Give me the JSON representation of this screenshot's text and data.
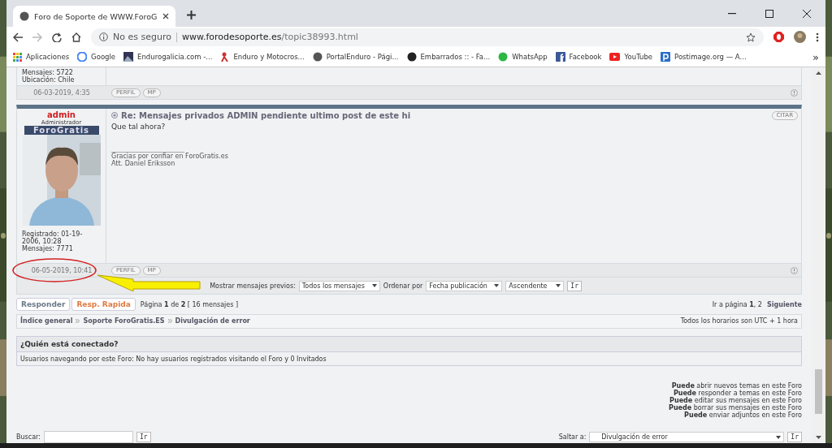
{
  "browser": {
    "tab_title": "Foro de Soporte de WWW.ForoG",
    "security": "No es seguro",
    "url_host": "www.forodesoporte.es",
    "url_path": "/topic38993.html",
    "bookmarks": [
      {
        "label": "Aplicaciones",
        "kind": "apps"
      },
      {
        "label": "Google",
        "kind": "google"
      },
      {
        "label": "Endurogalicia.com -..."
      },
      {
        "label": "Enduro y Motocros...",
        "kind": "rider"
      },
      {
        "label": "PortalEnduro - Pági...",
        "kind": "globe"
      },
      {
        "label": "Embarrados :: - Fa...",
        "kind": "dark"
      },
      {
        "label": "WhatsApp",
        "kind": "whatsapp"
      },
      {
        "label": "Facebook",
        "kind": "facebook"
      },
      {
        "label": "YouTube",
        "kind": "youtube"
      },
      {
        "label": "Postimage.org — A...",
        "kind": "postimage"
      }
    ],
    "more": "»"
  },
  "previous_post": {
    "profile_lines": [
      "Mensajes: 5722",
      "Ubicación: Chile"
    ],
    "date": "06-03-2019, 4:35",
    "buttons": [
      "PERFIL",
      "MP"
    ]
  },
  "post": {
    "author": "admin",
    "rank": "Administrador",
    "rank_banner": "ForoGratis",
    "profile_lines": [
      "Registrado: 01-19-2006, 10:28",
      "Mensajes: 7771"
    ],
    "title": "Re: Mensajes privados ADMIN pendiente ultimo post de este hi",
    "body": "Que tal ahora?",
    "signature": [
      "Gracias por confiar en ForoGratis.es",
      "Att. Daniel Eriksson"
    ],
    "quote_button": "CITAR",
    "date": "06-05-2019, 10:41",
    "buttons": [
      "PERFIL",
      "MP"
    ]
  },
  "options": {
    "show_label": "Mostrar mensajes previos:",
    "show_value": "Todos los mensajes",
    "order_label": "Ordenar por",
    "order_value": "Fecha publicación",
    "direction_value": "Ascendente",
    "go": "Ir"
  },
  "actions": {
    "reply": "Responder",
    "quick_reply": "Resp. Rapida",
    "pagination": "Página **1** de **2**  [ 16 mensajes ]",
    "goto": "Ir a página **1**, 2",
    "next": "Siguiente"
  },
  "breadcrumb": {
    "items": [
      "Índice general",
      "Soporte ForoGratis.ES",
      "Divulgación de error"
    ],
    "timezone": "Todos los horarios son UTC + 1 hora"
  },
  "online": {
    "title": "¿Quién está conectado?",
    "text": "Usuarios navegando por este Foro: No hay usuarios registrados visitando el Foro y 0 Invitados"
  },
  "permissions": [
    "**Puede** abrir nuevos temas en este Foro",
    "**Puede** responder a temas en este Foro",
    "**Puede** editar sus mensajes en este Foro",
    "**Puede** borrar sus mensajes en este Foro",
    "**Puede** enviar adjuntos en este Foro"
  ],
  "search": {
    "label": "Buscar:",
    "go": "Ir"
  },
  "jump": {
    "label": "Saltar a:",
    "value": "Divulgación de error",
    "go": "Ir"
  }
}
